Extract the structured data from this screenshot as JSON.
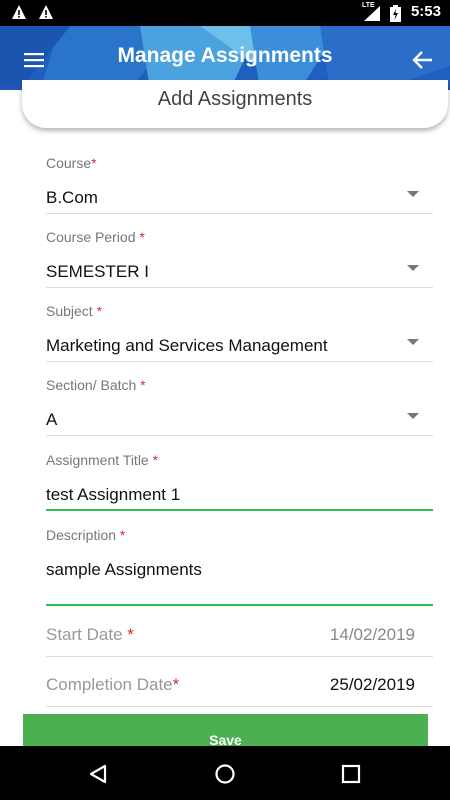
{
  "status_bar": {
    "time": "5:53",
    "network": "LTE",
    "icons": [
      "warning-icon",
      "warning-icon",
      "signal-icon",
      "battery-icon"
    ]
  },
  "app_bar": {
    "title": "Manage Assignments",
    "menu_icon": "hamburger-menu-icon",
    "back_icon": "arrow-left-icon",
    "colors": {
      "primary": "#1f5fbf",
      "accent_light": "#4aa3df"
    }
  },
  "header_card": {
    "label": "Add Assignments"
  },
  "form": {
    "required_marker": "*",
    "course": {
      "label": "Course",
      "value": "B.Com"
    },
    "course_period": {
      "label": "Course Period",
      "value": "SEMESTER I"
    },
    "subject": {
      "label": "Subject",
      "value": "Marketing and Services Management"
    },
    "section": {
      "label": "Section/ Batch",
      "value": "A"
    },
    "assignment_title": {
      "label": "Assignment Title",
      "value": "test Assignment 1"
    },
    "description": {
      "label": "Description",
      "value": "sample Assignments"
    },
    "start_date": {
      "label": "Start Date",
      "value": "14/02/2019"
    },
    "completion_date": {
      "label": "Completion Date",
      "value": "25/02/2019"
    },
    "colors": {
      "required": "#d32f2f",
      "focus_line": "#2fbe58"
    }
  },
  "save": {
    "label": "Save",
    "color": "#4caf50"
  },
  "nav_bar": {
    "icons": [
      "back-triangle-icon",
      "home-circle-icon",
      "recents-square-icon"
    ]
  }
}
